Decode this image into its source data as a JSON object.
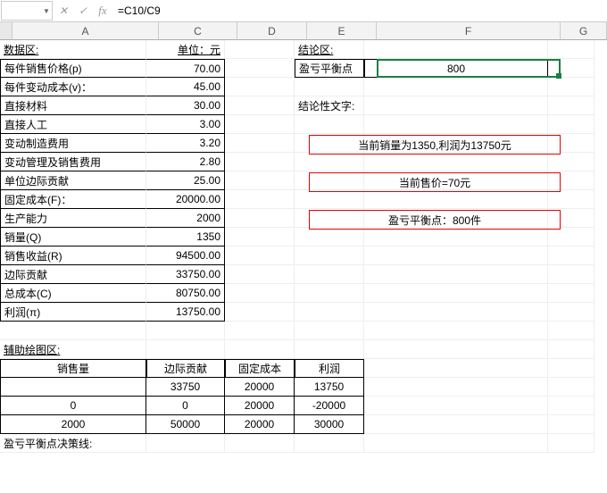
{
  "formula_bar": {
    "name_box": "",
    "formula": "=C10/C9"
  },
  "columns": [
    "A",
    "B",
    "C",
    "D",
    "E",
    "F",
    "G"
  ],
  "data_area": {
    "header": "数据区:",
    "unit_label": "单位：元",
    "rows": [
      {
        "label": "每件销售价格(p)",
        "val": "70.00"
      },
      {
        "label": "每件变动成本(v)：",
        "val": "45.00"
      },
      {
        "label": "  直接材料",
        "val": "30.00"
      },
      {
        "label": "  直接人工",
        "val": "3.00"
      },
      {
        "label": "  变动制造费用",
        "val": "3.20"
      },
      {
        "label": "  变动管理及销售费用",
        "val": "2.80"
      },
      {
        "label": "单位边际贡献",
        "val": "25.00"
      },
      {
        "label": "固定成本(F)：",
        "val": "20000.00"
      },
      {
        "label": "生产能力",
        "val": "2000"
      },
      {
        "label": "销量(Q)",
        "val": "1350"
      },
      {
        "label": "销售收益(R)",
        "val": "94500.00"
      },
      {
        "label": "边际贡献",
        "val": "33750.00"
      },
      {
        "label": "总成本(C)",
        "val": "80750.00"
      },
      {
        "label": "利润(π)",
        "val": "13750.00"
      }
    ]
  },
  "conclusion": {
    "header": "结论区:",
    "bep_label": "盈亏平衡点",
    "bep_value": "800",
    "text_header": "结论性文字:",
    "boxes": [
      "当前销量为1350,利润为13750元",
      "当前售价=70元",
      "盈亏平衡点：800件"
    ]
  },
  "aux": {
    "header": "辅助绘图区:",
    "cols": [
      "销售量",
      "边际贡献",
      "固定成本",
      "利润"
    ],
    "rows": [
      [
        "",
        "33750",
        "20000",
        "13750"
      ],
      [
        "0",
        "0",
        "20000",
        "-20000"
      ],
      [
        "2000",
        "50000",
        "20000",
        "30000"
      ]
    ],
    "footer": "盈亏平衡点决策线:"
  }
}
